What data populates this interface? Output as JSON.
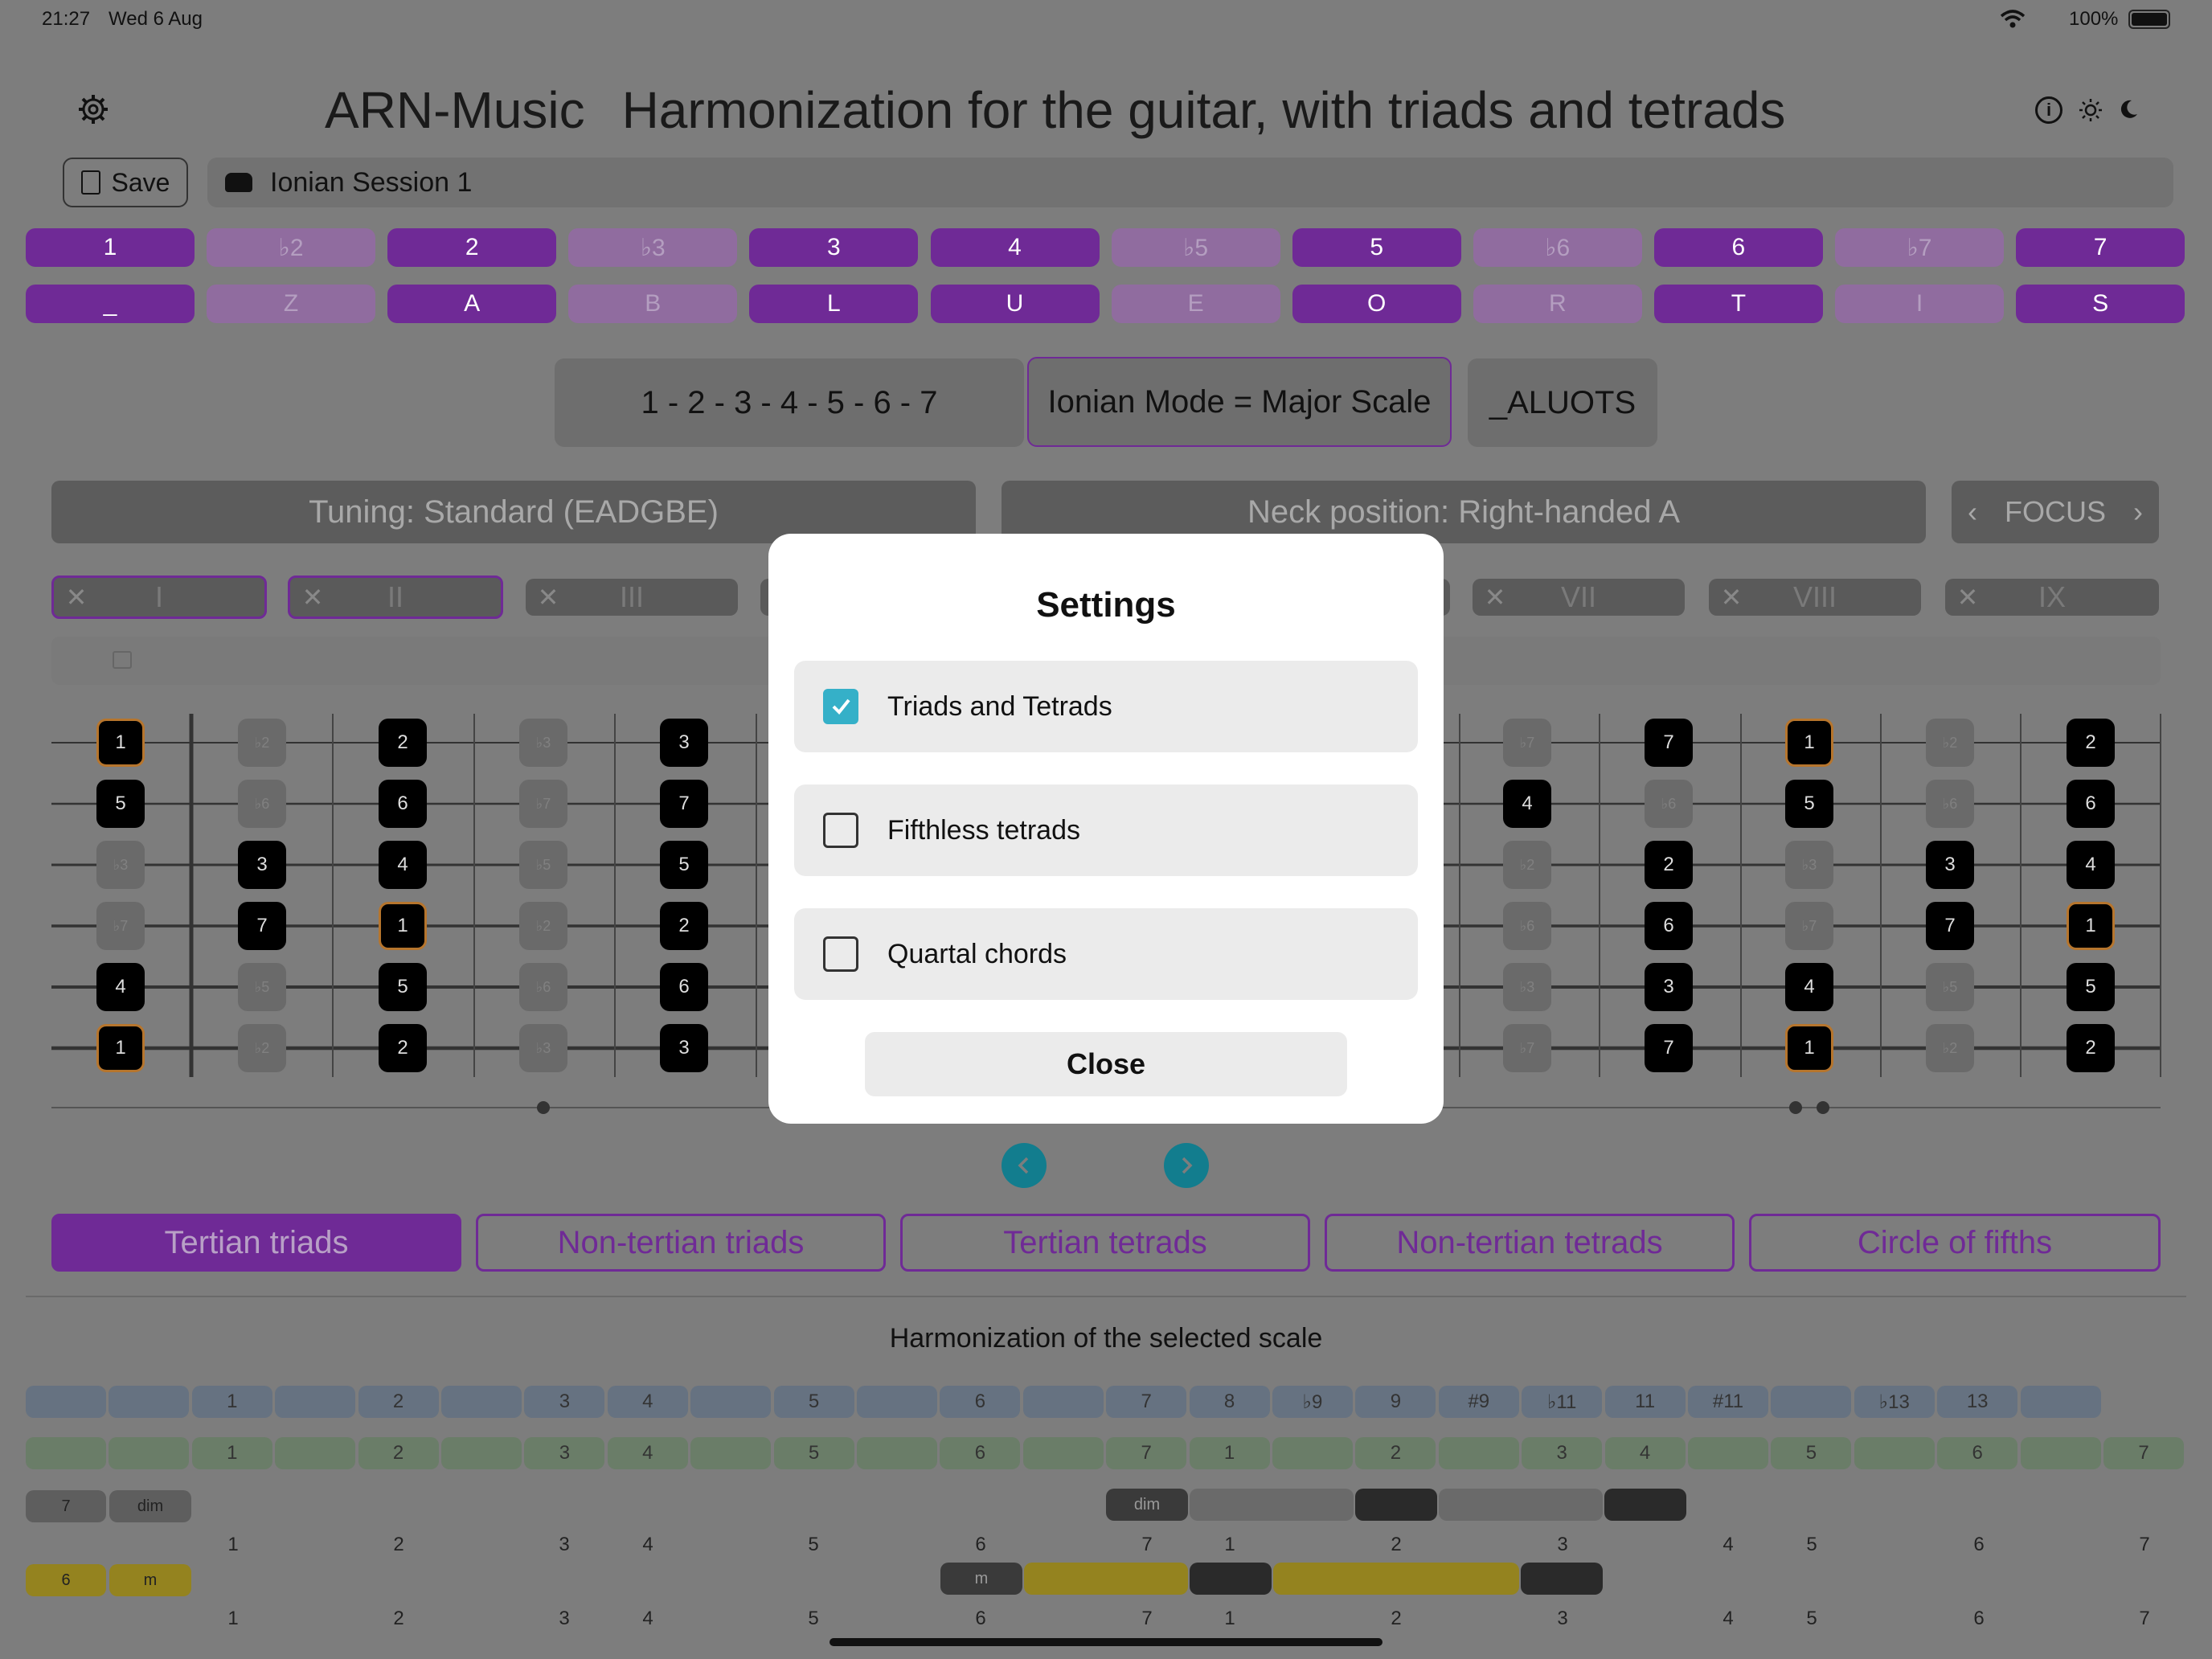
{
  "status": {
    "time": "21:27",
    "date": "Wed 6 Aug",
    "battery": "100%"
  },
  "header": {
    "app_name": "ARN-Music",
    "subtitle": "Harmonization for the guitar, with triads and tetrads"
  },
  "toolbar": {
    "save_label": "Save",
    "session_name": "Ionian Session 1"
  },
  "degrees": [
    {
      "label": "1",
      "on": true
    },
    {
      "label": "♭2",
      "on": false
    },
    {
      "label": "2",
      "on": true
    },
    {
      "label": "♭3",
      "on": false
    },
    {
      "label": "3",
      "on": true
    },
    {
      "label": "4",
      "on": true
    },
    {
      "label": "♭5",
      "on": false
    },
    {
      "label": "5",
      "on": true
    },
    {
      "label": "♭6",
      "on": false
    },
    {
      "label": "6",
      "on": true
    },
    {
      "label": "♭7",
      "on": false
    },
    {
      "label": "7",
      "on": true
    }
  ],
  "letters": [
    {
      "label": "_",
      "on": true
    },
    {
      "label": "Z",
      "on": false
    },
    {
      "label": "A",
      "on": true
    },
    {
      "label": "B",
      "on": false
    },
    {
      "label": "L",
      "on": true
    },
    {
      "label": "U",
      "on": true
    },
    {
      "label": "E",
      "on": false
    },
    {
      "label": "O",
      "on": true
    },
    {
      "label": "R",
      "on": false
    },
    {
      "label": "T",
      "on": true
    },
    {
      "label": "I",
      "on": false
    },
    {
      "label": "S",
      "on": true
    }
  ],
  "scale": {
    "formula": "1 - 2 - 3 - 4 - 5 - 6 - 7",
    "mode_name": "Ionian Mode = Major Scale",
    "code": "_ALUOTS"
  },
  "tuning_label": "Tuning: Standard (EADGBE)",
  "neck_label": "Neck position: Right-handed A",
  "focus_label": "FOCUS",
  "modes": [
    "I",
    "II",
    "III",
    "VII",
    "VIII",
    "IX"
  ],
  "fretboard": {
    "left": [
      [
        "1",
        "♭2",
        "2",
        "♭3",
        "3"
      ],
      [
        "5",
        "♭6",
        "6",
        "♭7",
        "7"
      ],
      [
        "♭3",
        "3",
        "4",
        "♭5",
        "5"
      ],
      [
        "♭7",
        "7",
        "1",
        "♭2",
        "2"
      ],
      [
        "4",
        "♭5",
        "5",
        "♭6",
        "6"
      ],
      [
        "1",
        "♭2",
        "2",
        "♭3",
        "3"
      ]
    ],
    "right": [
      [
        "♭7",
        "7",
        "1",
        "♭2",
        "2"
      ],
      [
        "4",
        "♭6",
        "5",
        "♭6",
        "6"
      ],
      [
        "♭2",
        "2",
        "♭3",
        "3",
        "4"
      ],
      [
        "♭6",
        "6",
        "♭7",
        "7",
        "1"
      ],
      [
        "♭3",
        "3",
        "4",
        "♭5",
        "5"
      ],
      [
        "♭7",
        "7",
        "1",
        "♭2",
        "2"
      ]
    ]
  },
  "tabs": [
    "Tertian triads",
    "Non-tertian triads",
    "Tertian tetrads",
    "Non-tertian tetrads",
    "Circle of fifths"
  ],
  "harmonization": {
    "title": "Harmonization of the selected scale",
    "row1": [
      "",
      "",
      "1",
      "",
      "2",
      "",
      "3",
      "4",
      "",
      "5",
      "",
      "6",
      "",
      "7",
      "8",
      "♭9",
      "9",
      "#9",
      "♭11",
      "11",
      "#11",
      "",
      "♭13",
      "13",
      ""
    ],
    "row2": [
      "",
      "",
      "1",
      "",
      "2",
      "",
      "3",
      "4",
      "",
      "5",
      "",
      "6",
      "",
      "7",
      "1",
      "",
      "2",
      "",
      "3",
      "4",
      "",
      "5",
      "",
      "6",
      "",
      "7"
    ],
    "nums": [
      "1",
      "2",
      "3",
      "4",
      "5",
      "6",
      "7",
      "1",
      "2",
      "3",
      "4",
      "5",
      "6",
      "7"
    ],
    "chord7": {
      "degree": "7",
      "quality": "dim",
      "tag": "dim"
    },
    "chord6": {
      "degree": "6",
      "quality": "m",
      "tag": "m"
    }
  },
  "settings": {
    "title": "Settings",
    "options": [
      {
        "label": "Triads and Tetrads",
        "checked": true
      },
      {
        "label": "Fifthless tetrads",
        "checked": false
      },
      {
        "label": "Quartal chords",
        "checked": false
      }
    ],
    "close_label": "Close"
  }
}
